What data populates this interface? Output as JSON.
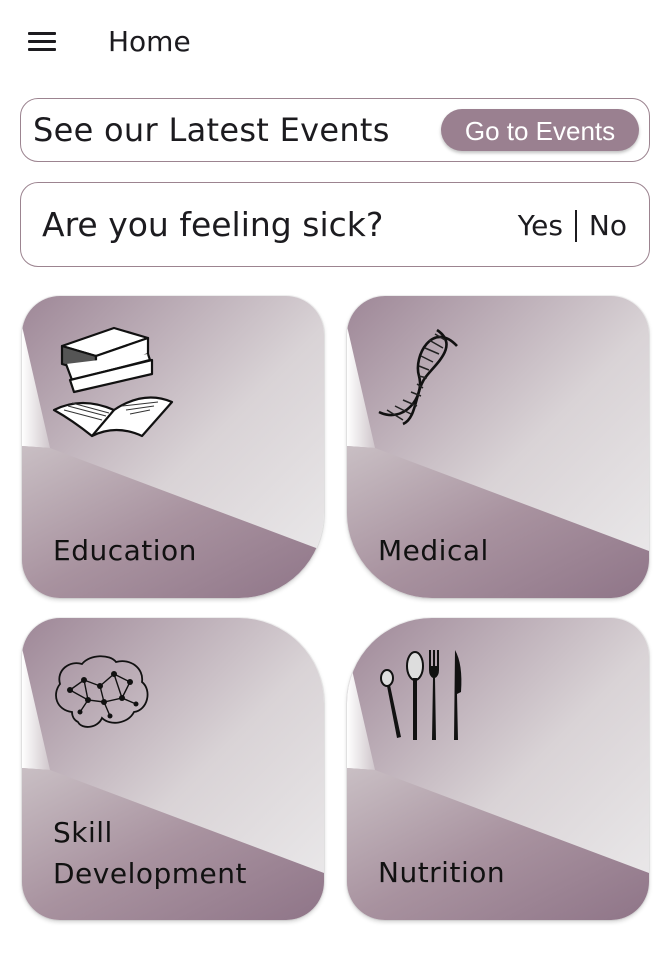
{
  "header": {
    "title": "Home",
    "menu_icon": "hamburger-menu-icon"
  },
  "events": {
    "text": "See our Latest Events",
    "button_label": "Go to Events"
  },
  "sick": {
    "question": "Are you feeling sick?",
    "yes_label": "Yes",
    "no_label": "No"
  },
  "tiles": [
    {
      "label": "Education",
      "icon": "books-icon"
    },
    {
      "label": "Medical",
      "icon": "dna-icon"
    },
    {
      "label_line1": "Skill",
      "label_line2": "Development",
      "icon": "brain-network-icon"
    },
    {
      "label": "Nutrition",
      "icon": "cutlery-icon"
    }
  ],
  "colors": {
    "accent": "#9a8090",
    "border": "#9c8490",
    "tile_dark": "#947a8c",
    "tile_light": "#e8e4e6"
  }
}
